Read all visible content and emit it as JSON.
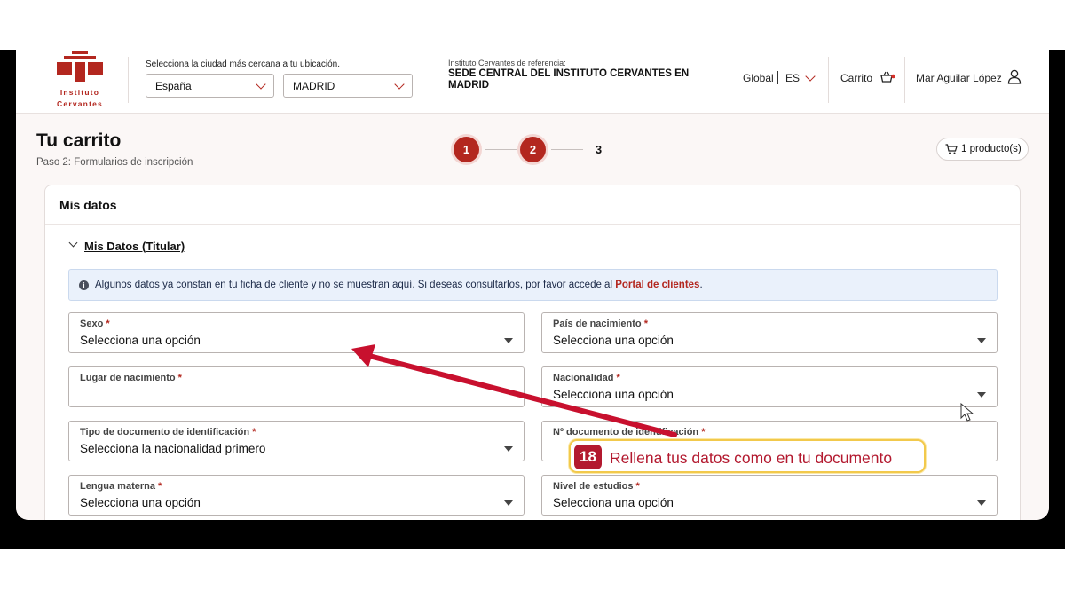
{
  "header": {
    "logo_line1": "Instituto",
    "logo_line2": "Cervantes",
    "city_label": "Selecciona la ciudad más cercana a tu ubicación.",
    "country_select": "España",
    "city_select": "MADRID",
    "ref_label": "Instituto Cervantes de referencia:",
    "ref_name": "SEDE CENTRAL DEL INSTITUTO CERVANTES EN MADRID",
    "global_label": "Global",
    "lang_label": "ES",
    "cart_label": "Carrito",
    "user_name": "Mar Aguilar López"
  },
  "page": {
    "title": "Tu carrito",
    "subtitle": "Paso 2: Formularios de inscripción",
    "steps": [
      "1",
      "2",
      "3"
    ],
    "cart_count": "1 producto(s)"
  },
  "card": {
    "title": "Mis datos",
    "section_title": "Mis Datos (Titular)",
    "info_text": "Algunos datos ya constan en tu ficha de cliente y no se muestran aquí. Si deseas consultarlos, por favor accede al ",
    "info_link": "Portal de clientes",
    "info_end": "."
  },
  "fields": [
    {
      "label": "Sexo",
      "value": "Selecciona una opción"
    },
    {
      "label": "País de nacimiento",
      "value": "Selecciona una opción"
    },
    {
      "label": "Lugar de nacimiento",
      "value": ""
    },
    {
      "label": "Nacionalidad",
      "value": "Selecciona una opción"
    },
    {
      "label": "Tipo de documento de identificación",
      "value": "Selecciona la nacionalidad primero"
    },
    {
      "label": "Nº documento de identificación",
      "value": ""
    },
    {
      "label": "Lengua materna",
      "value": "Selecciona una opción"
    },
    {
      "label": "Nivel de estudios",
      "value": "Selecciona una opción"
    }
  ],
  "annotation": {
    "step_number": "18",
    "text": "Rellena tus datos como en tu documento"
  },
  "colors": {
    "brand": "#b3271f",
    "callout_border": "#f2c94c",
    "info_bg": "#eaf1fb"
  }
}
